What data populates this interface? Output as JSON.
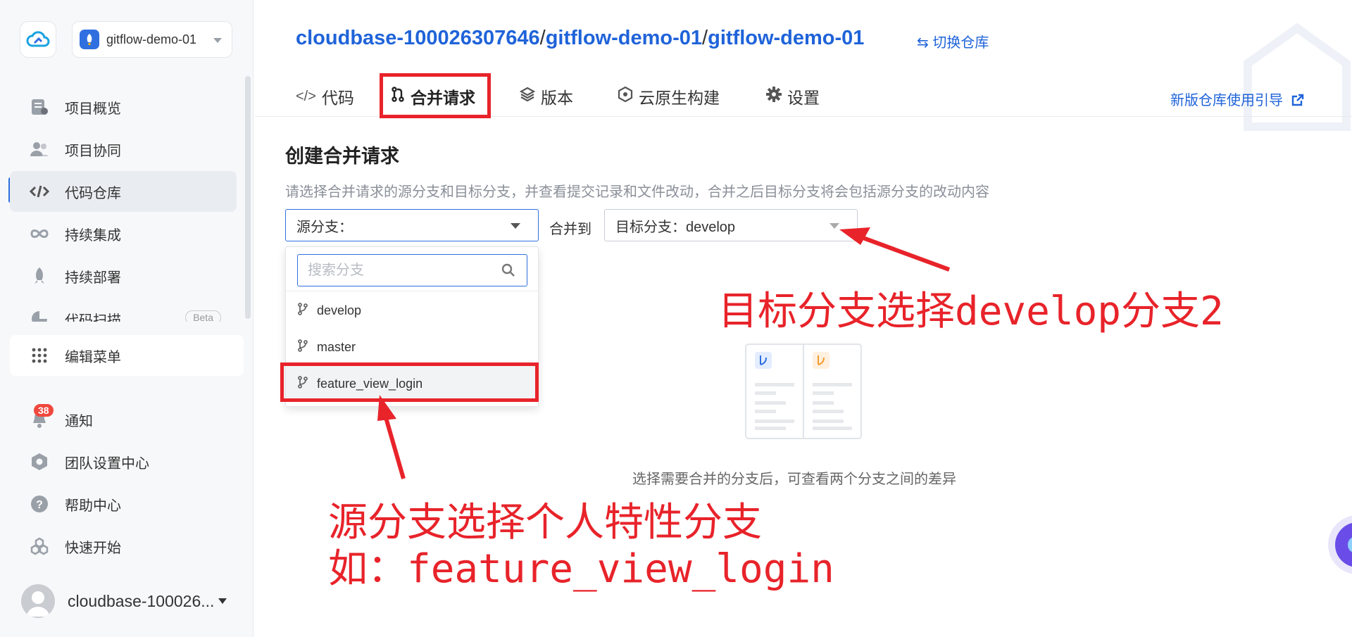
{
  "sidebar": {
    "project_name": "gitflow-demo-01",
    "items": [
      {
        "label": "项目概览",
        "icon": "overview-icon"
      },
      {
        "label": "项目协同",
        "icon": "team-icon"
      },
      {
        "label": "代码仓库",
        "icon": "code-icon"
      },
      {
        "label": "持续集成",
        "icon": "infinity-icon"
      },
      {
        "label": "持续部署",
        "icon": "rocket-icon"
      },
      {
        "label": "代码扫描",
        "icon": "scan-icon",
        "badge": "Beta"
      }
    ],
    "edit_menu_label": "编辑菜单",
    "bottom_items": [
      {
        "label": "通知",
        "icon": "bell-icon",
        "count": "38"
      },
      {
        "label": "团队设置中心",
        "icon": "settings-hex-icon"
      },
      {
        "label": "帮助中心",
        "icon": "help-icon"
      },
      {
        "label": "快速开始",
        "icon": "start-icon"
      }
    ],
    "user_name": "cloudbase-100026..."
  },
  "header": {
    "breadcrumb": [
      "cloudbase-100026307646",
      "gitflow-demo-01",
      "gitflow-demo-01"
    ],
    "breadcrumb_sep": "/",
    "switch_repo": "⇆ 切换仓库",
    "tabs": [
      {
        "label": "代码"
      },
      {
        "label": "合并请求"
      },
      {
        "label": "版本"
      },
      {
        "label": "云原生构建"
      },
      {
        "label": "设置"
      }
    ],
    "guide_link": "新版仓库使用引导"
  },
  "main": {
    "title": "创建合并请求",
    "description": "请选择合并请求的源分支和目标分支，并查看提交记录和文件改动，合并之后目标分支将会包括源分支的改动内容",
    "source_select_label": "源分支：",
    "merge_to": "合并到",
    "target_select_label": "目标分支：develop",
    "dropdown": {
      "search_placeholder": "搜索分支",
      "branches": [
        "develop",
        "master",
        "feature_view_login"
      ],
      "highlighted": "feature_view_login"
    },
    "empty_text": "选择需要合并的分支后，可查看两个分支之间的差异"
  },
  "annotations": {
    "target_note": "目标分支选择develop分支2",
    "source_note_line1": "源分支选择个人特性分支",
    "source_note_line2": "如：feature_view_login"
  },
  "colors": {
    "accent": "#1f63d9",
    "annotation_red": "#e8232a",
    "badge_red": "#f0483e",
    "sidebar_bg": "#f7f8fa"
  }
}
